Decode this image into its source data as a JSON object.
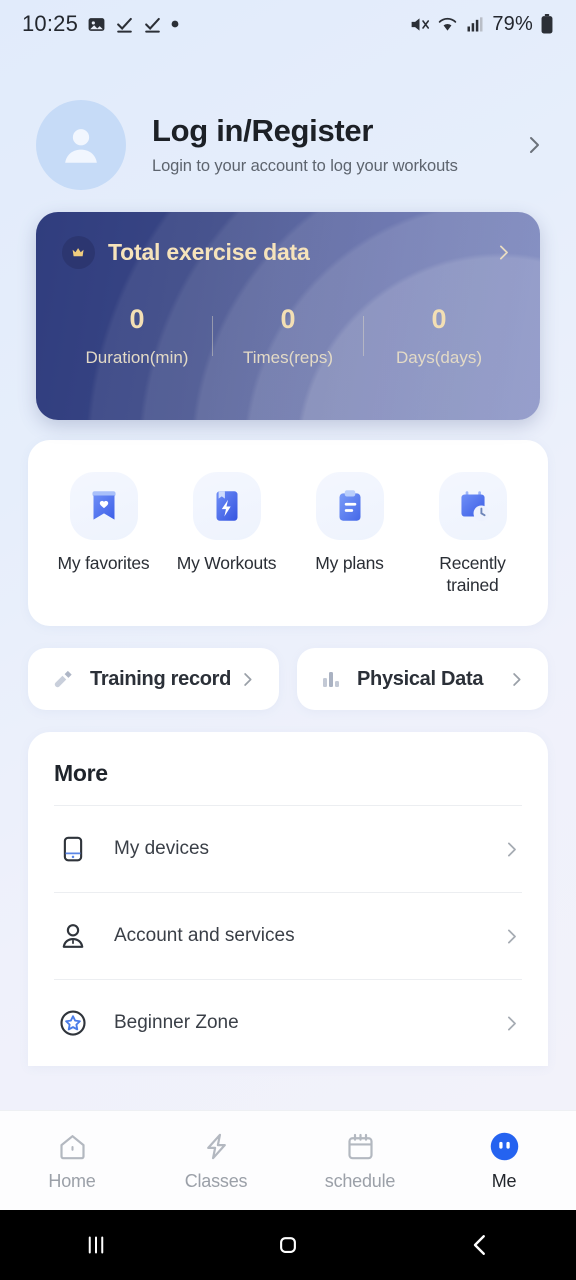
{
  "status_bar": {
    "time": "10:25",
    "battery_text": "79%",
    "left_icons": [
      "image-icon",
      "checkmark-icon",
      "checkmark-icon",
      "dot-icon"
    ],
    "right_icons": [
      "mute-icon",
      "wifi-icon",
      "signal-icon",
      "battery-icon"
    ]
  },
  "profile": {
    "title": "Log in/Register",
    "subtitle": "Login to your account to log your workouts",
    "avatar_icon": "person-avatar-icon",
    "chevron_icon": "chevron-right-icon"
  },
  "total_card": {
    "title": "Total exercise data",
    "badge_icon": "crown-icon",
    "chevron_icon": "chevron-right-icon",
    "stats": [
      {
        "value": "0",
        "label": "Duration(min)"
      },
      {
        "value": "0",
        "label": "Times(reps)"
      },
      {
        "value": "0",
        "label": "Days(days)"
      }
    ],
    "colors": {
      "bg_start": "#303d7e",
      "bg_end": "#5463ab",
      "text": "#f3dfb4"
    }
  },
  "quick_actions": [
    {
      "label": "My favorites",
      "icon": "bookmark-heart-icon"
    },
    {
      "label": "My Workouts",
      "icon": "book-lightning-icon"
    },
    {
      "label": "My plans",
      "icon": "clipboard-icon"
    },
    {
      "label": "Recently trained",
      "icon": "calendar-clock-icon"
    }
  ],
  "pills": [
    {
      "label": "Training record",
      "icon": "dumbbell-icon",
      "chevron_icon": "chevron-right-icon"
    },
    {
      "label": "Physical Data",
      "icon": "bar-chart-icon",
      "chevron_icon": "chevron-right-icon"
    }
  ],
  "more": {
    "title": "More",
    "rows": [
      {
        "label": "My devices",
        "icon": "device-icon",
        "chevron_icon": "chevron-right-icon"
      },
      {
        "label": "Account and services",
        "icon": "person-icon",
        "chevron_icon": "chevron-right-icon"
      },
      {
        "label": "Beginner Zone",
        "icon": "star-circle-icon",
        "chevron_icon": "chevron-right-icon"
      }
    ]
  },
  "bottom_nav": {
    "active": "Me",
    "accent": "#2563f0",
    "items": [
      {
        "label": "Home",
        "icon": "home-icon"
      },
      {
        "label": "Classes",
        "icon": "lightning-icon"
      },
      {
        "label": "schedule",
        "icon": "calendar-icon"
      },
      {
        "label": "Me",
        "icon": "me-face-icon"
      }
    ]
  },
  "android_nav": {
    "recents_icon": "recents-icon",
    "home_icon": "home-square-icon",
    "back_icon": "back-chevron-icon"
  }
}
